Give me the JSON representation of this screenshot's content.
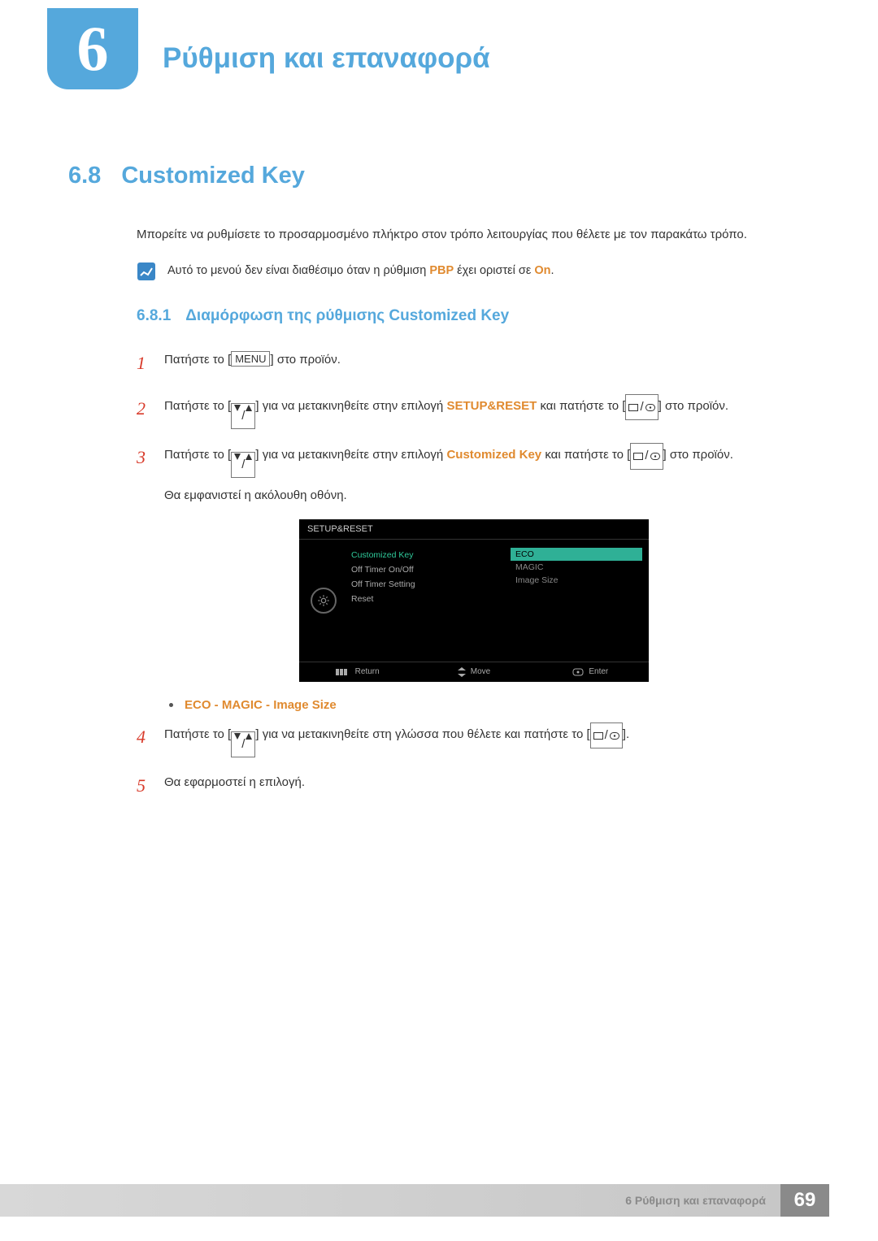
{
  "chapter": {
    "number": "6",
    "title": "Ρύθμιση και επαναφορά"
  },
  "section": {
    "number": "6.8",
    "title": "Customized Key"
  },
  "intro": "Μπορείτε να ρυθμίσετε το προσαρμοσμένο πλήκτρο στον τρόπο λειτουργίας που θέλετε με τον παρακάτω τρόπο.",
  "note": {
    "prefix": "Αυτό το μενού δεν είναι διαθέσιμο όταν η ρύθμιση ",
    "keyword1": "PBP",
    "mid": " έχει οριστεί σε ",
    "keyword2": "On",
    "suffix": "."
  },
  "subsection": {
    "number": "6.8.1",
    "title": "Διαμόρφωση της ρύθμισης Customized Key"
  },
  "steps": {
    "s1": {
      "num": "1",
      "t1": "Πατήστε το [",
      "menu": "MENU",
      "t2": "] στο προϊόν."
    },
    "s2": {
      "num": "2",
      "t1": "Πατήστε το [",
      "t2": "] για να μετακινηθείτε στην επιλογή ",
      "kw": "SETUP&RESET",
      "t3": " και πατήστε το [",
      "t4": "] στο προϊόν."
    },
    "s3": {
      "num": "3",
      "t1": "Πατήστε το [",
      "t2": "] για να μετακινηθείτε στην επιλογή ",
      "kw": "Customized Key",
      "t3": " και πατήστε το [",
      "t4": "] στο προϊόν.",
      "below": "Θα εμφανιστεί η ακόλουθη οθόνη."
    },
    "s4": {
      "num": "4",
      "t1": "Πατήστε το [",
      "t2": "] για να μετακινηθείτε στη γλώσσα που θέλετε και πατήστε το [",
      "t3": "]."
    },
    "s5": {
      "num": "5",
      "text": "Θα εφαρμοστεί η επιλογή."
    }
  },
  "bullet": {
    "a": "ECO",
    "sep": " - ",
    "b": "MAGIC",
    "c": "Image Size"
  },
  "osd": {
    "title": "SETUP&RESET",
    "menu": {
      "i0": "Customized Key",
      "i1": "Off Timer On/Off",
      "i2": "Off Timer Setting",
      "i3": "Reset"
    },
    "options": {
      "o0": "ECO",
      "o1": "MAGIC",
      "o2": "Image Size"
    },
    "footer": {
      "f0": "Return",
      "f1": "Move",
      "f2": "Enter"
    }
  },
  "footer": {
    "text": "6 Ρύθμιση και επαναφορά",
    "page": "69"
  }
}
